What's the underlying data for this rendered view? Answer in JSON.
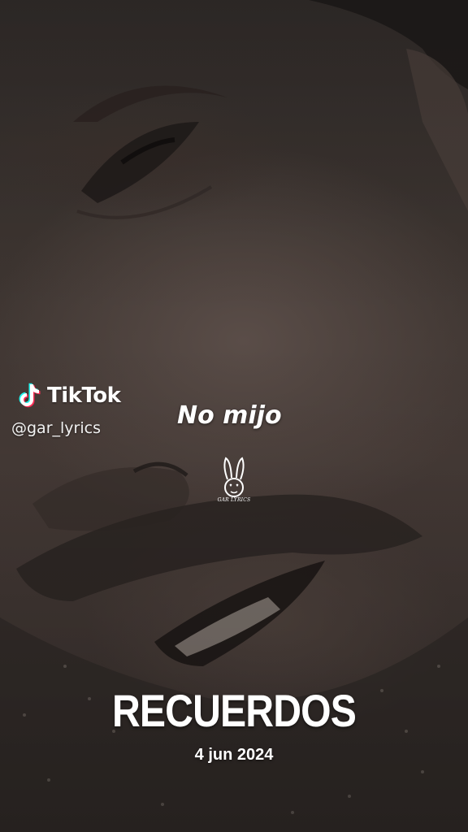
{
  "watermark": {
    "brand": "TikTok",
    "handle": "@gar_lyrics",
    "icon": "tiktok-note-icon"
  },
  "lyric_caption": "No mijo",
  "logo": {
    "icon": "bunny-logo-icon",
    "text": "GAR LYRICS"
  },
  "title": "RECUERDOS",
  "date": "4 jun 2024",
  "colors": {
    "text": "#ffffff",
    "tiktok_cyan": "#25f4ee",
    "tiktok_red": "#fe2c55"
  }
}
